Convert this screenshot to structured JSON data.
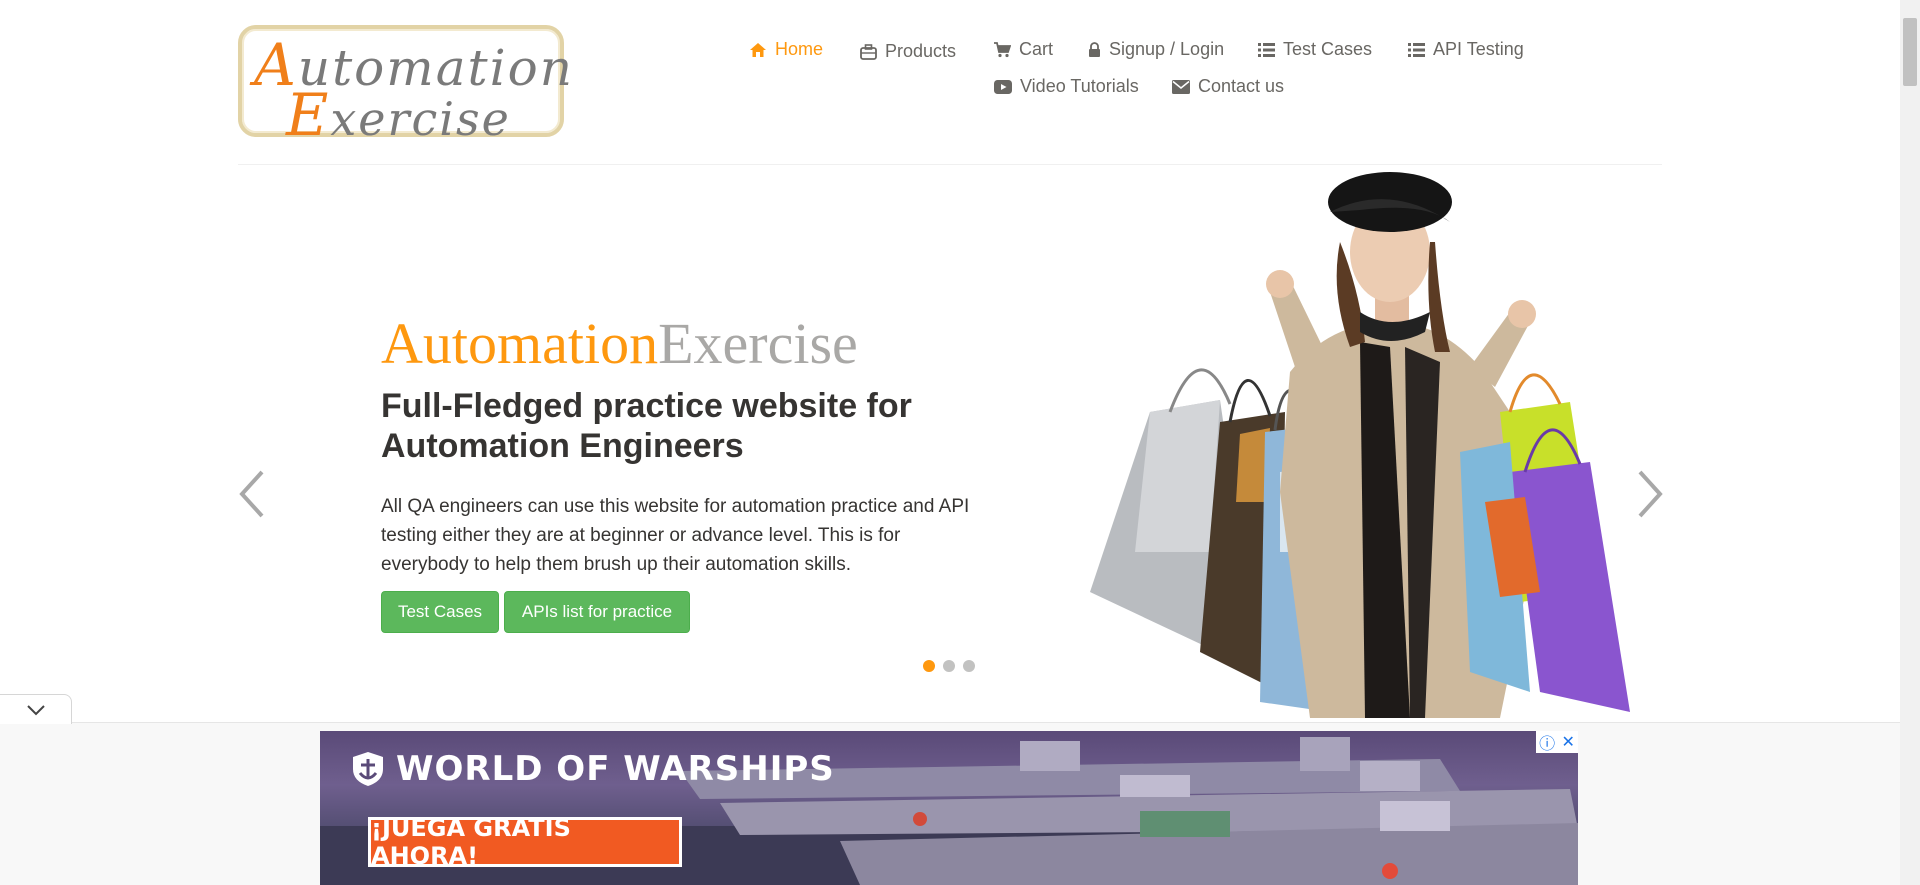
{
  "header": {
    "logo_alt": "Automation Exercise",
    "logo_line1_cap": "A",
    "logo_line1_rest": "utomation",
    "logo_line2_cap": "E",
    "logo_line2_rest": "xercise",
    "nav": {
      "home": "Home",
      "products": "Products",
      "cart": "Cart",
      "signup_login": "Signup / Login",
      "test_cases": "Test Cases",
      "api_testing": "API Testing",
      "video_tutorials": "Video Tutorials",
      "contact_us": "Contact us"
    },
    "active_nav": "home"
  },
  "hero": {
    "brand_part1": "Automation",
    "brand_part2": "Exercise",
    "headline": "Full-Fledged practice website for Automation Engineers",
    "description": "All QA engineers can use this website for automation practice and API testing either they are at beginner or advance level. This is for everybody to help them brush up their automation skills.",
    "button_test_cases": "Test Cases",
    "button_apis": "APIs list for practice",
    "slides_total": 3,
    "slide_active": 1
  },
  "ad": {
    "title": "WORLD OF WARSHIPS",
    "cta": "¡JUEGA GRATIS AHORA!",
    "info_icon": "ⓘ",
    "close_icon": "✕"
  },
  "colors": {
    "accent_orange": "#fe980f",
    "button_green": "#5cb85c",
    "text_dark": "#363432",
    "nav_grey": "#696763",
    "ad_cta": "#f15a22"
  }
}
